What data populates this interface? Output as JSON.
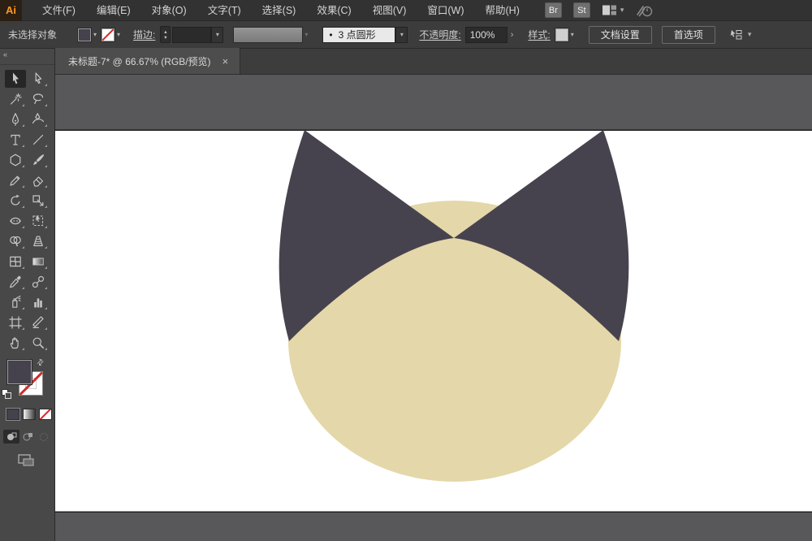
{
  "menu_bar": {
    "logo": "Ai",
    "items": [
      {
        "id": "file",
        "label": "文件(F)"
      },
      {
        "id": "edit",
        "label": "编辑(E)"
      },
      {
        "id": "object",
        "label": "对象(O)"
      },
      {
        "id": "type",
        "label": "文字(T)"
      },
      {
        "id": "select",
        "label": "选择(S)"
      },
      {
        "id": "effect",
        "label": "效果(C)"
      },
      {
        "id": "view",
        "label": "视图(V)"
      },
      {
        "id": "window",
        "label": "窗口(W)"
      },
      {
        "id": "help",
        "label": "帮助(H)"
      }
    ],
    "badges": [
      {
        "id": "bridge",
        "label": "Br"
      },
      {
        "id": "stock",
        "label": "St"
      }
    ],
    "workspace_chevron": "▾",
    "share_icon": "share-sync-icon"
  },
  "control_bar": {
    "selection_status": "未选择对象",
    "stroke_label": "描边:",
    "stepper_up": "▴",
    "stepper_down": "▾",
    "brush_bullet": "•",
    "brush_name": "3 点圆形",
    "opacity_label": "不透明度:",
    "opacity_value": "100%",
    "opacity_expand": "›",
    "style_label": "样式:",
    "document_setup_label": "文档设置",
    "preferences_label": "首选项",
    "chevron": "▾"
  },
  "document_tab": {
    "title": "未标题-7* @ 66.67% (RGB/预览)",
    "close_glyph": "×"
  },
  "toolbar": {
    "collapse_glyph": "«",
    "tools": [
      {
        "id": "selection",
        "active": true
      },
      {
        "id": "direct-selection"
      },
      {
        "id": "magic-wand"
      },
      {
        "id": "lasso"
      },
      {
        "id": "pen"
      },
      {
        "id": "curvature"
      },
      {
        "id": "type"
      },
      {
        "id": "line-segment"
      },
      {
        "id": "shape"
      },
      {
        "id": "paintbrush"
      },
      {
        "id": "pencil"
      },
      {
        "id": "eraser"
      },
      {
        "id": "rotate"
      },
      {
        "id": "scale"
      },
      {
        "id": "width"
      },
      {
        "id": "free-transform"
      },
      {
        "id": "shape-builder"
      },
      {
        "id": "perspective-grid"
      },
      {
        "id": "mesh"
      },
      {
        "id": "gradient"
      },
      {
        "id": "eyedropper"
      },
      {
        "id": "blend"
      },
      {
        "id": "symbol-sprayer"
      },
      {
        "id": "graph"
      },
      {
        "id": "artboard"
      },
      {
        "id": "slice"
      },
      {
        "id": "hand"
      },
      {
        "id": "zoom"
      }
    ],
    "swap_glyph": "⇄"
  },
  "swatches": {
    "fill": "#45424d",
    "stroke": "none",
    "none_slash_red": "#d42a2a",
    "style_swatch": "#cfcfcf"
  },
  "canvas": {
    "zoom_percent": "66.67%",
    "color_mode": "RGB/预览",
    "colors": {
      "pasteboard": "#58585a",
      "artboard": "#ffffff",
      "artboard_border": "#1d1d1d",
      "head": "#e4d7a9",
      "ears": "#47434e"
    }
  }
}
